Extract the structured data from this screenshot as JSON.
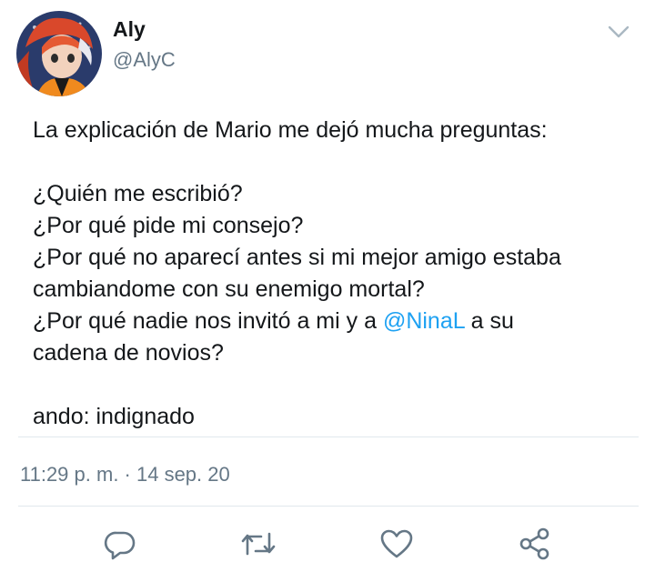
{
  "tweet": {
    "author": {
      "name": "Aly",
      "handle": "@AlyC",
      "avatar_icon": "anime-character-avatar"
    },
    "text": {
      "line1": "La explicación de Mario me dejó mucha preguntas:",
      "line2": "¿Quién me escribió?",
      "line3": "¿Por qué pide mi consejo?",
      "line4": "¿Por qué no aparecí antes si mi mejor amigo estaba",
      "line5": "cambiandome con su enemigo mortal?",
      "line6_before": "¿Por qué nadie nos invitó a mi y a ",
      "line6_mention": "@NinaL",
      "line6_after": " a su",
      "line7": "cadena de novios?",
      "line8": "ando: indignado"
    },
    "timestamp": "11:29 p. m. · 14 sep. 20",
    "actions": {
      "reply_icon": "reply-icon",
      "retweet_icon": "retweet-icon",
      "like_icon": "heart-icon",
      "share_icon": "share-icon"
    }
  },
  "colors": {
    "text": "#14171a",
    "secondary": "#657786",
    "mention": "#1da1f2",
    "divider": "#e1e8ed"
  }
}
